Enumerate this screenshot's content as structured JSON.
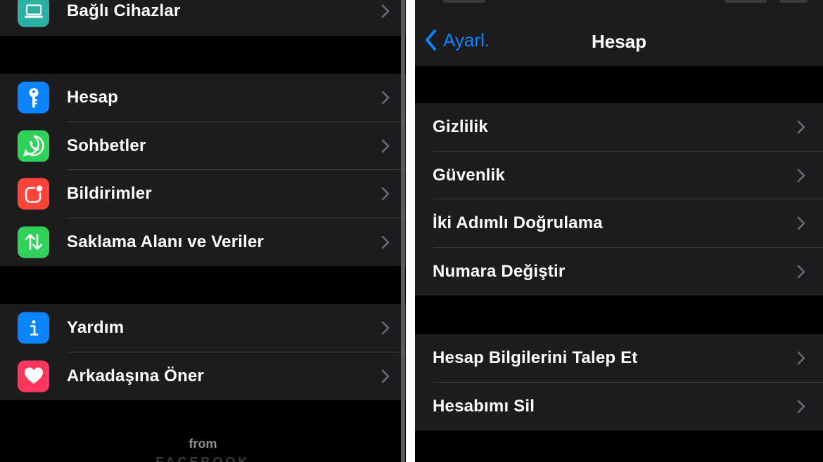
{
  "left": {
    "top_item": {
      "label": "Bağlı Cihazlar",
      "icon": "laptop-icon",
      "color": "#2bb0a2"
    },
    "group1": [
      {
        "label": "Hesap",
        "icon": "key-icon",
        "color": "#0a84ff"
      },
      {
        "label": "Sohbetler",
        "icon": "whatsapp-icon",
        "color": "#30d158"
      },
      {
        "label": "Bildirimler",
        "icon": "notification-icon",
        "color": "#ff453a"
      },
      {
        "label": "Saklama Alanı ve Veriler",
        "icon": "storage-arrows-icon",
        "color": "#30d158"
      }
    ],
    "group2": [
      {
        "label": "Yardım",
        "icon": "info-icon",
        "color": "#0a84ff"
      },
      {
        "label": "Arkadaşına Öner",
        "icon": "heart-icon",
        "color": "#ff375f"
      }
    ],
    "footer": {
      "from": "from",
      "brand": "FACEBOOK"
    }
  },
  "right": {
    "nav": {
      "back_label": "Ayarl.",
      "title": "Hesap"
    },
    "group1": [
      {
        "label": "Gizlilik"
      },
      {
        "label": "Güvenlik"
      },
      {
        "label": "İki Adımlı Doğrulama"
      },
      {
        "label": "Numara Değiştir"
      }
    ],
    "group2": [
      {
        "label": "Hesap Bilgilerini Talep Et"
      },
      {
        "label": "Hesabımı Sil"
      }
    ]
  }
}
